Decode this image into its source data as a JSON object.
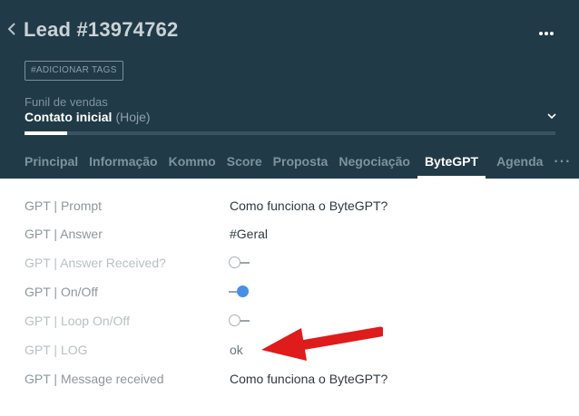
{
  "header": {
    "title": "Lead #13974762",
    "add_tags": "#ADICIONAR TAGS",
    "funnel_label": "Funil de vendas",
    "stage_name": "Contato inicial",
    "stage_time": "(Hoje)",
    "stage_progress": 0.08
  },
  "tabs": [
    {
      "label": "Principal"
    },
    {
      "label": "Informação"
    },
    {
      "label": "Kommo"
    },
    {
      "label": "Score"
    },
    {
      "label": "Proposta"
    },
    {
      "label": "Negociação"
    },
    {
      "label": "ByteGPT",
      "active": true
    },
    {
      "label": "Agenda"
    }
  ],
  "tabs_more": "···",
  "fields": [
    {
      "label": "GPT | Prompt",
      "value": "Como funciona o ByteGPT?"
    },
    {
      "label": "GPT | Answer",
      "value": "#Geral"
    },
    {
      "label": "GPT | Answer Received?",
      "toggle": false
    },
    {
      "label": "GPT | On/Off",
      "toggle": true
    },
    {
      "label": "GPT | Loop On/Off",
      "toggle": false
    },
    {
      "label": "GPT | LOG",
      "value": "ok"
    },
    {
      "label": "GPT | Message received",
      "value": "Como funciona o ByteGPT?"
    }
  ],
  "colors": {
    "header_bg": "#213a47",
    "toggle_on": "#4a8fe6",
    "annotation_arrow": "#e01b1b"
  },
  "icons": {
    "back": "chevron-left-icon",
    "more": "more-dots-icon",
    "dropdown": "chevron-down-icon"
  }
}
